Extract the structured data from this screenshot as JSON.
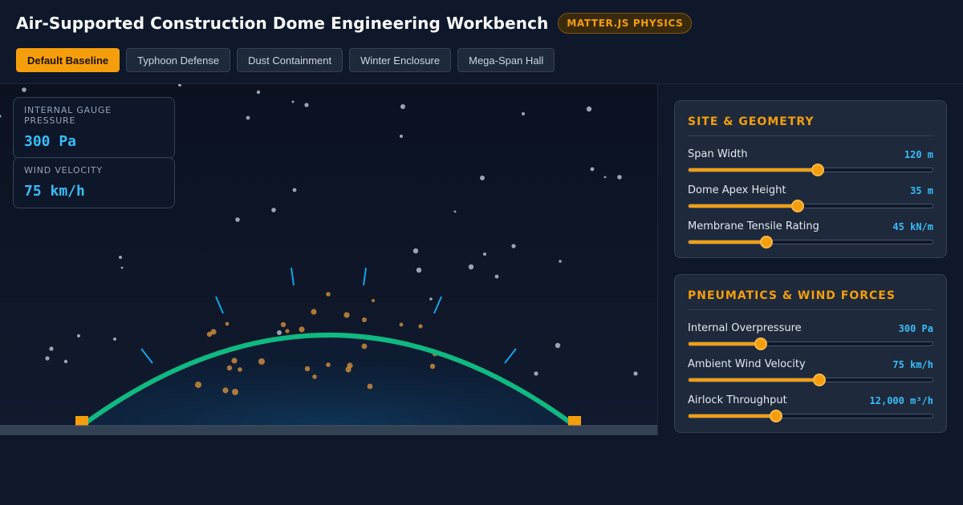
{
  "header": {
    "title": "Air-Supported Construction Dome Engineering Workbench",
    "badge": "MATTER.JS PHYSICS"
  },
  "presets": [
    {
      "label": "Default Baseline",
      "active": true
    },
    {
      "label": "Typhoon Defense",
      "active": false
    },
    {
      "label": "Dust Containment",
      "active": false
    },
    {
      "label": "Winter Enclosure",
      "active": false
    },
    {
      "label": "Mega-Span Hall",
      "active": false
    }
  ],
  "readouts": {
    "pressure": {
      "label": "INTERNAL GAUGE PRESSURE",
      "value": "300 Pa"
    },
    "wind": {
      "label": "WIND VELOCITY",
      "value": "75 km/h"
    }
  },
  "panels": {
    "site": {
      "title": "SITE & GEOMETRY",
      "controls": [
        {
          "label": "Span Width",
          "value": "120 m",
          "level": 0.53
        },
        {
          "label": "Dome Apex Height",
          "value": "35 m",
          "level": 0.446
        },
        {
          "label": "Membrane Tensile Rating",
          "value": "45 kN/m",
          "level": 0.32
        }
      ]
    },
    "pneumatics": {
      "title": "PNEUMATICS & WIND FORCES",
      "controls": [
        {
          "label": "Internal Overpressure",
          "value": "300 Pa",
          "level": 0.297
        },
        {
          "label": "Ambient Wind Velocity",
          "value": "75 km/h",
          "level": 0.536
        },
        {
          "label": "Airlock Throughput",
          "value": "12,000 m³/h",
          "level": 0.36
        }
      ]
    }
  },
  "colors": {
    "accent": "#f59e0b",
    "value": "#38bdf8",
    "membrane": "#10b981",
    "background": "#0f172a"
  }
}
